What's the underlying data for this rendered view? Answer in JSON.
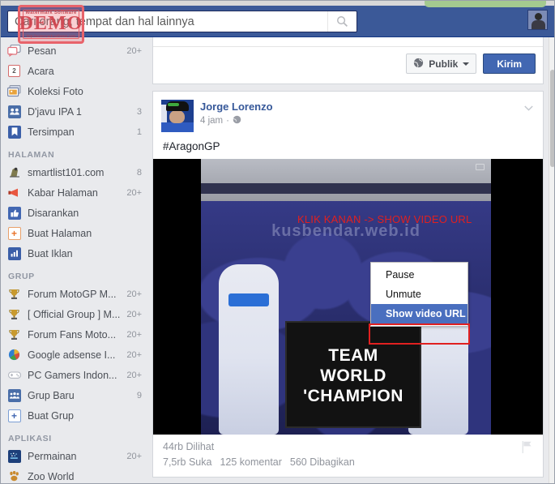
{
  "topbar": {
    "search_placeholder": "Cari orang, tempat dan hal lainnya",
    "search_value": "",
    "search_icon": "search-icon",
    "avatar_alt": "profile-avatar"
  },
  "watermark": {
    "top_text": "Watermark Software",
    "main_text": "DEMO",
    "url_text": "http://watermark-software.com"
  },
  "sidebar": {
    "items": [
      {
        "label": "Pesan",
        "count": "20+",
        "icon": "messages-icon"
      },
      {
        "label": "Acara",
        "count": "",
        "icon": "calendar-icon",
        "badge": "2"
      },
      {
        "label": "Koleksi Foto",
        "count": "",
        "icon": "photos-icon"
      },
      {
        "label": "D'javu IPA 1",
        "count": "3",
        "icon": "friends-icon"
      },
      {
        "label": "Tersimpan",
        "count": "1",
        "icon": "bookmark-icon"
      }
    ],
    "sections": [
      {
        "heading": "HALAMAN",
        "items": [
          {
            "label": "smartlist101.com",
            "count": "8",
            "icon": "page-icon"
          },
          {
            "label": "Kabar Halaman",
            "count": "20+",
            "icon": "megaphone-icon"
          },
          {
            "label": "Disarankan",
            "count": "",
            "icon": "thumbs-up-icon"
          },
          {
            "label": "Buat Halaman",
            "count": "",
            "icon": "plus-page-icon"
          },
          {
            "label": "Buat Iklan",
            "count": "",
            "icon": "chart-icon"
          }
        ]
      },
      {
        "heading": "GRUP",
        "items": [
          {
            "label": "Forum MotoGP M...",
            "count": "20+",
            "icon": "trophy-icon"
          },
          {
            "label": "[ Official Group ] M...",
            "count": "20+",
            "icon": "trophy-icon"
          },
          {
            "label": "Forum Fans Moto...",
            "count": "20+",
            "icon": "trophy-icon"
          },
          {
            "label": "Google adsense I...",
            "count": "20+",
            "icon": "globe-pie-icon"
          },
          {
            "label": "PC Gamers Indon...",
            "count": "20+",
            "icon": "gamepad-icon"
          },
          {
            "label": "Grup Baru",
            "count": "9",
            "icon": "group-icon"
          },
          {
            "label": "Buat Grup",
            "count": "",
            "icon": "plus-group-icon"
          }
        ]
      },
      {
        "heading": "APLIKASI",
        "items": [
          {
            "label": "Permainan",
            "count": "20+",
            "icon": "games-icon"
          },
          {
            "label": "Zoo World",
            "count": "",
            "icon": "paw-icon"
          }
        ]
      }
    ]
  },
  "composer": {
    "audience_label": "Publik",
    "audience_icon": "globe-icon",
    "submit_label": "Kirim"
  },
  "post": {
    "author": "Jorge Lorenzo",
    "time": "4 jam",
    "meta_separator": "·",
    "privacy_icon": "globe-icon",
    "chevron_icon": "chevron-down-icon",
    "text": "#AragonGP",
    "annotation": "KLIK KANAN -> SHOW VIDEO URL",
    "video": {
      "banner_lines": [
        "TEAM",
        "WORLD",
        "'CHAMPION"
      ],
      "overlay_watermark": "kusbendar.web.id",
      "cc_icon": "closed-caption-icon"
    },
    "stats": {
      "views": "44rb Dilihat",
      "likes": "7,5rb Suka",
      "comments": "125 komentar",
      "shares": "560 Dibagikan",
      "flag_icon": "flag-icon"
    }
  },
  "context_menu": {
    "items": [
      {
        "label": "Pause",
        "selected": false
      },
      {
        "label": "Unmute",
        "selected": false
      },
      {
        "label": "Show video URL",
        "selected": true
      }
    ]
  },
  "colors": {
    "facebook_blue": "#3b5998",
    "button_blue": "#4267b2",
    "annotation_red": "#e02020",
    "highlight_blue": "#4a6fbf",
    "page_bg": "#e9eaed"
  }
}
